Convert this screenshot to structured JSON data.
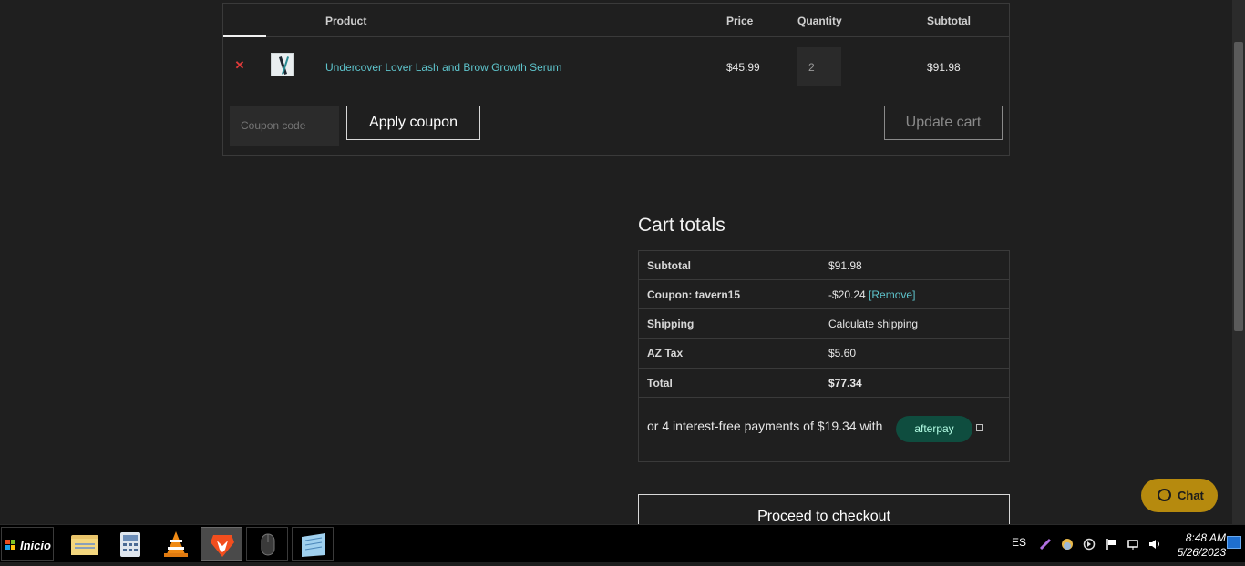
{
  "cart": {
    "headers": {
      "product": "Product",
      "price": "Price",
      "quantity": "Quantity",
      "subtotal": "Subtotal"
    },
    "items": [
      {
        "name": "Undercover Lover Lash and Brow Growth Serum",
        "price": "$45.99",
        "quantity": "2",
        "subtotal": "$91.98"
      }
    ],
    "coupon_placeholder": "Coupon code",
    "apply_coupon_label": "Apply coupon",
    "update_cart_label": "Update cart"
  },
  "totals": {
    "title": "Cart totals",
    "rows": {
      "subtotal": {
        "label": "Subtotal",
        "value": "$91.98"
      },
      "coupon": {
        "label": "Coupon: tavern15",
        "value": "-$20.24",
        "remove": "[Remove]"
      },
      "shipping": {
        "label": "Shipping",
        "value": "Calculate shipping"
      },
      "tax": {
        "label": "AZ Tax",
        "value": "$5.60"
      },
      "total": {
        "label": "Total",
        "value": "$77.34"
      }
    },
    "afterpay_text": "or 4 interest-free payments of $19.34 with",
    "afterpay_badge": "afterpay",
    "checkout_label": "Proceed to checkout"
  },
  "chat": {
    "label": "Chat"
  },
  "taskbar": {
    "start_label": "Inicio",
    "apps": [
      "file-explorer",
      "calculator",
      "vlc",
      "brave",
      "mouse-settings",
      "notepad"
    ],
    "language": "ES",
    "time": "8:48 AM",
    "date": "5/26/2023"
  },
  "colors": {
    "accent_link": "#5ec4cc",
    "remove": "#e03a3a",
    "chat": "#b68a0e",
    "afterpay_bg": "#0f4d3f",
    "afterpay_text": "#b2fce4"
  }
}
